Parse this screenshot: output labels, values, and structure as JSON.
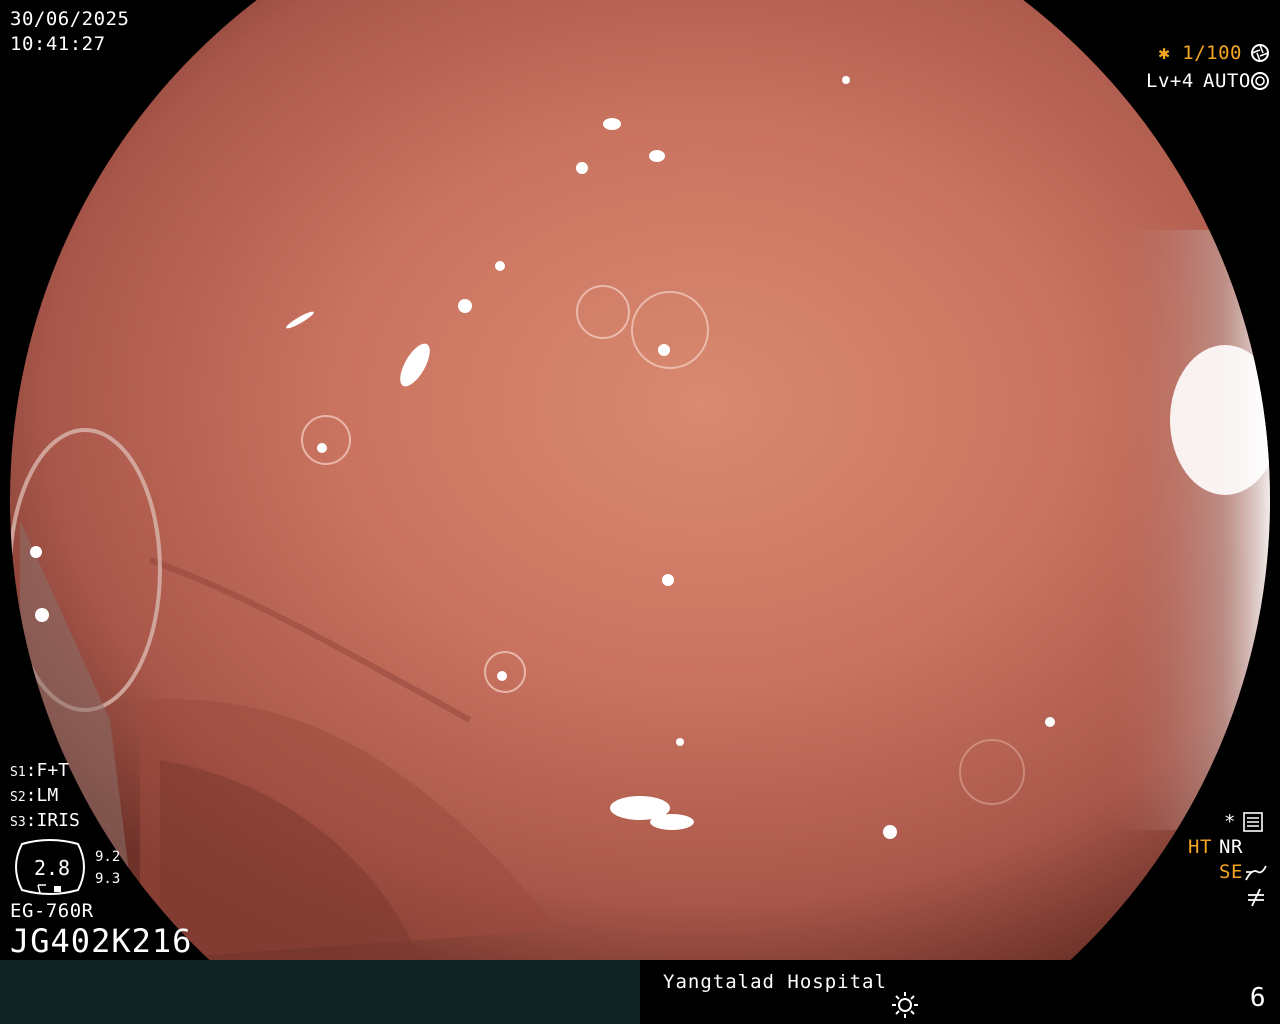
{
  "datetime": {
    "date": "30/06/2025",
    "time": "10:41:27"
  },
  "exposure": {
    "shutter": "✱ 1/100",
    "level": "Lv+4",
    "mode": "AUTO"
  },
  "switches": [
    {
      "key": "S1",
      "value": "F+T"
    },
    {
      "key": "S2",
      "value": "LM"
    },
    {
      "key": "S3",
      "value": "IRIS"
    }
  ],
  "gauge": {
    "value": "2.8",
    "upper": "9.2",
    "lower": "9.3"
  },
  "scope_model": "EG-760R",
  "scope_serial": "JG402K216",
  "right_panel": {
    "asterisk": "*",
    "ht": "HT",
    "nr": "NR",
    "se": "SE"
  },
  "footer": {
    "hospital": "Yangtalad Hospital",
    "page": "6"
  },
  "colors": {
    "accent_orange": "#f5a623",
    "footer_left": "#0f2325",
    "tissue": "#c86f5c"
  },
  "icons": [
    "aperture-icon",
    "auto-iris-icon",
    "settings-icon",
    "se-curve-icon",
    "not-equal-icon",
    "brightness-icon"
  ]
}
